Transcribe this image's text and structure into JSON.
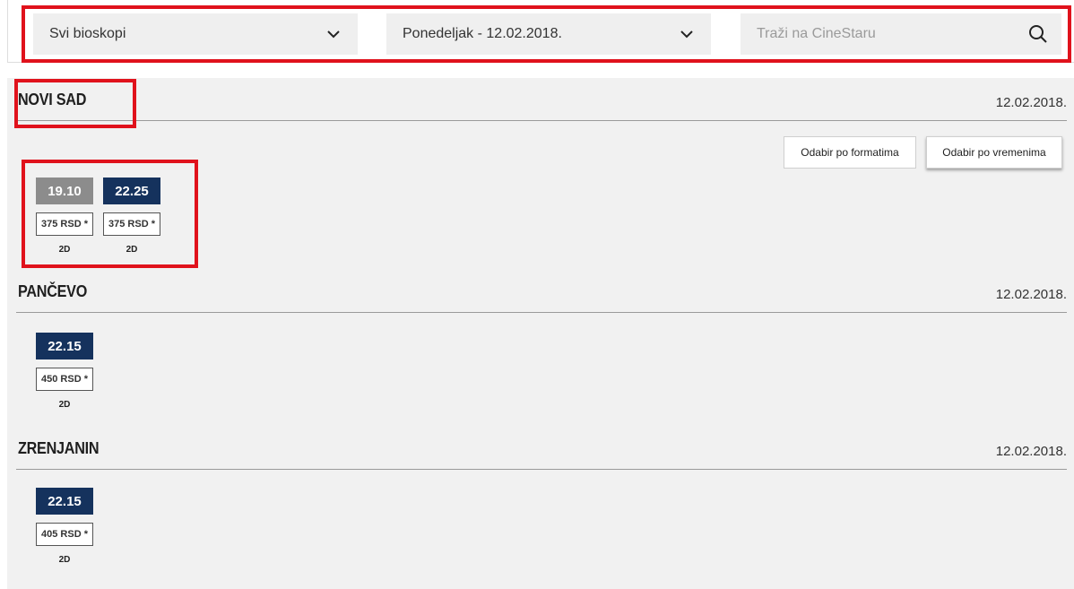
{
  "filters": {
    "cinema_select": {
      "value": "Svi bioskopi"
    },
    "date_select": {
      "value": "Ponedeljak - 12.02.2018."
    },
    "search": {
      "placeholder": "Traži na CineStaru"
    }
  },
  "view_buttons": {
    "formats_label": "Odabir po formatima",
    "times_label": "Odabir po vremenima"
  },
  "cities": [
    {
      "name": "NOVI SAD",
      "date": "12.02.2018.",
      "showtimes": [
        {
          "time": "19.10",
          "price": "375 RSD *",
          "format": "2D",
          "state": "past"
        },
        {
          "time": "22.25",
          "price": "375 RSD *",
          "format": "2D",
          "state": "active"
        }
      ]
    },
    {
      "name": "PANČEVO",
      "date": "12.02.2018.",
      "showtimes": [
        {
          "time": "22.15",
          "price": "450 RSD *",
          "format": "2D",
          "state": "active"
        }
      ]
    },
    {
      "name": "ZRENJANIN",
      "date": "12.02.2018.",
      "showtimes": [
        {
          "time": "22.15",
          "price": "405 RSD *",
          "format": "2D",
          "state": "active"
        }
      ]
    }
  ],
  "colors": {
    "highlight_red": "#e0121c",
    "badge_active": "#15325d",
    "badge_past": "#8c8c8c",
    "content_bg": "#f1f1f1"
  }
}
